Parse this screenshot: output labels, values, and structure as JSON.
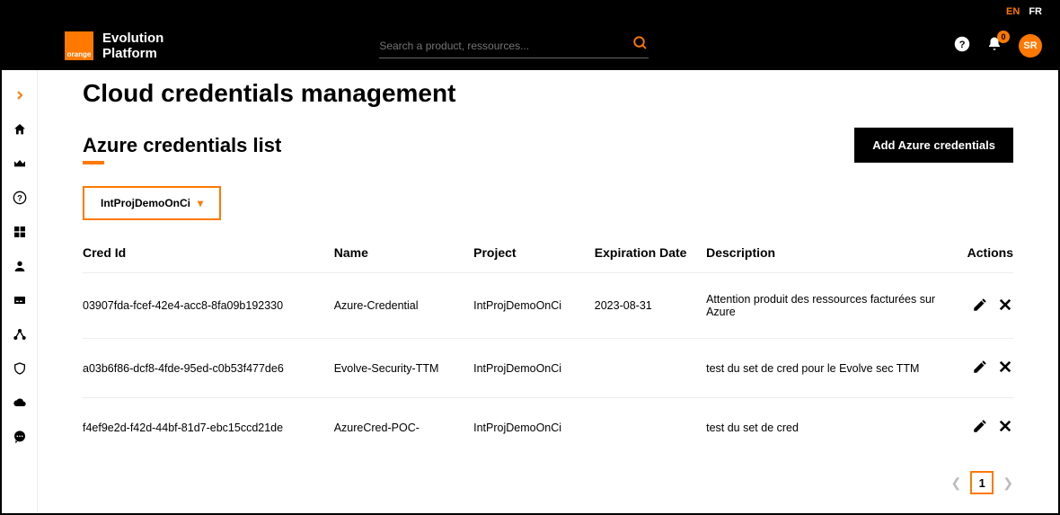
{
  "lang": {
    "en": "EN",
    "fr": "FR"
  },
  "brand": {
    "logo_text": "orange",
    "line1": "Evolution",
    "line2": "Platform"
  },
  "search": {
    "placeholder": "Search a product, ressources..."
  },
  "header": {
    "notif_count": "0",
    "avatar_initials": "SR"
  },
  "page": {
    "title": "Cloud credentials management",
    "section_title": "Azure credentials list",
    "add_button": "Add Azure credentials"
  },
  "filter": {
    "project": "IntProjDemoOnCi"
  },
  "table": {
    "headers": {
      "cred_id": "Cred Id",
      "name": "Name",
      "project": "Project",
      "expiration": "Expiration Date",
      "description": "Description",
      "actions": "Actions"
    },
    "rows": [
      {
        "cred_id": "03907fda-fcef-42e4-acc8-8fa09b192330",
        "name": "Azure-Credential",
        "project": "IntProjDemoOnCi",
        "expiration": "2023-08-31",
        "description": "Attention produit des ressources facturées sur Azure"
      },
      {
        "cred_id": "a03b6f86-dcf8-4fde-95ed-c0b53f477de6",
        "name": "Evolve-Security-TTM",
        "project": "IntProjDemoOnCi",
        "expiration": "",
        "description": "test du set de cred pour le Evolve sec TTM"
      },
      {
        "cred_id": "f4ef9e2d-f42d-44bf-81d7-ebc15ccd21de",
        "name": "AzureCred-POC-",
        "project": "IntProjDemoOnCi",
        "expiration": "",
        "description": "test du set de cred"
      }
    ]
  },
  "pager": {
    "current": "1"
  }
}
